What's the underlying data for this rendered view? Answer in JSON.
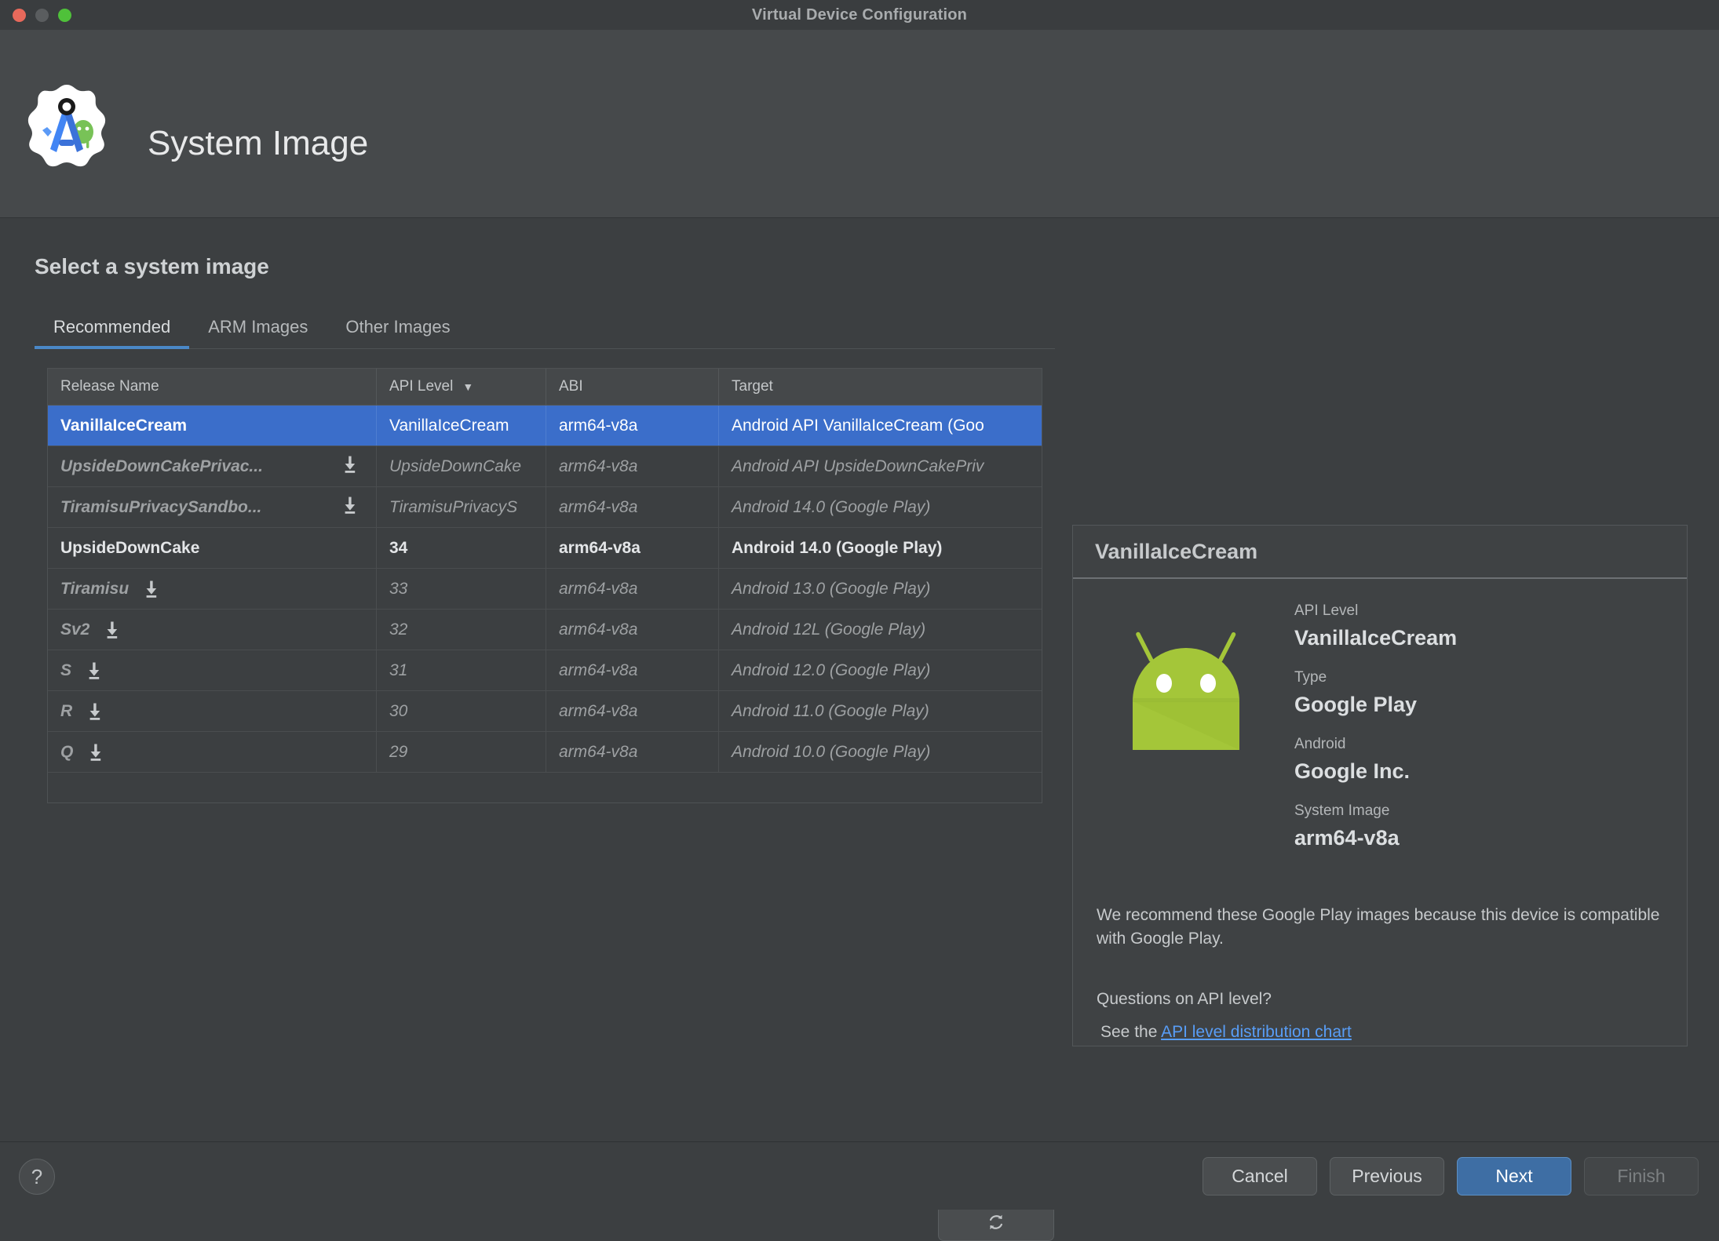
{
  "window": {
    "title": "Virtual Device Configuration",
    "traffic_lights": [
      "close",
      "minimize",
      "zoom"
    ]
  },
  "header": {
    "title": "System Image",
    "logo": "android-studio-logo"
  },
  "main": {
    "section_title": "Select a system image",
    "tabs": [
      {
        "label": "Recommended",
        "active": true
      },
      {
        "label": "ARM Images",
        "active": false
      },
      {
        "label": "Other Images",
        "active": false
      }
    ],
    "table": {
      "columns": [
        "Release Name",
        "API Level",
        "ABI",
        "Target"
      ],
      "sorted_column": "API Level",
      "sort_direction": "desc",
      "rows": [
        {
          "release_name": "VanillaIceCream",
          "api_level": "VanillaIceCream",
          "abi": "arm64-v8a",
          "target": "Android API VanillaIceCream (Goo",
          "state": "selected",
          "download": false,
          "download_position": "none"
        },
        {
          "release_name": "UpsideDownCakePrivac...",
          "api_level": "UpsideDownCake",
          "abi": "arm64-v8a",
          "target": "Android API UpsideDownCakePriv",
          "state": "notinstalled",
          "download": true,
          "download_position": "right"
        },
        {
          "release_name": "TiramisuPrivacySandbo...",
          "api_level": "TiramisuPrivacyS",
          "abi": "arm64-v8a",
          "target": "Android 14.0 (Google Play)",
          "state": "notinstalled",
          "download": true,
          "download_position": "right"
        },
        {
          "release_name": "UpsideDownCake",
          "api_level": "34",
          "abi": "arm64-v8a",
          "target": "Android 14.0 (Google Play)",
          "state": "installed",
          "download": false,
          "download_position": "none"
        },
        {
          "release_name": "Tiramisu",
          "api_level": "33",
          "abi": "arm64-v8a",
          "target": "Android 13.0 (Google Play)",
          "state": "notinstalled",
          "download": true,
          "download_position": "inline"
        },
        {
          "release_name": "Sv2",
          "api_level": "32",
          "abi": "arm64-v8a",
          "target": "Android 12L (Google Play)",
          "state": "notinstalled",
          "download": true,
          "download_position": "inline"
        },
        {
          "release_name": "S",
          "api_level": "31",
          "abi": "arm64-v8a",
          "target": "Android 12.0 (Google Play)",
          "state": "notinstalled",
          "download": true,
          "download_position": "inline"
        },
        {
          "release_name": "R",
          "api_level": "30",
          "abi": "arm64-v8a",
          "target": "Android 11.0 (Google Play)",
          "state": "notinstalled",
          "download": true,
          "download_position": "inline"
        },
        {
          "release_name": "Q",
          "api_level": "29",
          "abi": "arm64-v8a",
          "target": "Android 10.0 (Google Play)",
          "state": "notinstalled",
          "download": true,
          "download_position": "inline"
        }
      ]
    },
    "refresh_button": {
      "icon": "refresh-icon"
    }
  },
  "detail": {
    "title": "VanillaIceCream",
    "image_icon": "android-robot-icon",
    "fields": [
      {
        "label": "API Level",
        "value": "VanillaIceCream"
      },
      {
        "label": "Type",
        "value": "Google Play"
      },
      {
        "label": "Android",
        "value": "Google Inc."
      },
      {
        "label": "System Image",
        "value": "arm64-v8a"
      }
    ],
    "note": "We recommend these Google Play images because this device is compatible with Google Play.",
    "question": "Questions on API level?",
    "see_prefix": "See the ",
    "link_text": "API level distribution chart"
  },
  "footer": {
    "help_icon": "?",
    "buttons": [
      {
        "label": "Cancel",
        "style": "normal"
      },
      {
        "label": "Previous",
        "style": "normal"
      },
      {
        "label": "Next",
        "style": "primary"
      },
      {
        "label": "Finish",
        "style": "disabled"
      }
    ]
  },
  "colors": {
    "accent_blue": "#3b6eca",
    "link_blue": "#589df6",
    "tab_underline": "#4a88c7",
    "android_green": "#a4c639",
    "window_bg": "#3c3f41"
  }
}
